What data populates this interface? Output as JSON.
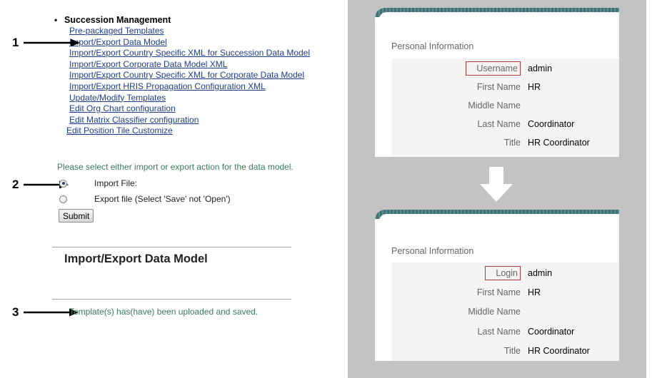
{
  "menu": {
    "title": "Succession Management",
    "bullet": "•",
    "items": [
      "Pre-packaged Templates",
      "Import/Export Data Model",
      "Import/Export Country Specific XML for Succession Data Model",
      "Import/Export Corporate Data Model XML",
      "Import/Export Country Specific XML for Corporate Data Model",
      "Import/Export HRIS Propagation Configuration XML",
      "Update/Modify Templates",
      "Edit Org Chart configuration",
      "Edit Matrix Classifier configuration",
      "Edit Position Tile Customize"
    ]
  },
  "callouts": [
    "1",
    "2",
    "3"
  ],
  "form": {
    "instruction": "Please select either import or export action for the data model.",
    "import_label": "Import File:",
    "export_label": "Export file (Select 'Save' not 'Open')",
    "submit_label": "Submit"
  },
  "section_title": "Import/Export Data Model",
  "status_message": "Template(s) has(have) been uploaded and saved.",
  "card_before": {
    "heading": "Personal Information",
    "rows": [
      {
        "label": "Username",
        "value": "admin"
      },
      {
        "label": "First Name",
        "value": "HR"
      },
      {
        "label": "Middle Name",
        "value": ""
      },
      {
        "label": "Last Name",
        "value": "Coordinator"
      },
      {
        "label": "Title",
        "value": "HR Coordinator"
      }
    ]
  },
  "card_after": {
    "heading": "Personal Information",
    "rows": [
      {
        "label": "Login",
        "value": "admin"
      },
      {
        "label": "First Name",
        "value": "HR"
      },
      {
        "label": "Middle Name",
        "value": ""
      },
      {
        "label": "Last Name",
        "value": "Coordinator"
      },
      {
        "label": "Title",
        "value": "HR Coordinator"
      }
    ]
  },
  "colors": {
    "link": "#1f3d8f",
    "status_green": "#3a7a5a",
    "highlight_box": "#b13a3a",
    "panel_gray": "#c3c3c3",
    "card_header_teal": "#3d7176"
  },
  "icons": [
    "black-right-arrow-icon",
    "white-down-arrow-icon",
    "radio-icon"
  ]
}
